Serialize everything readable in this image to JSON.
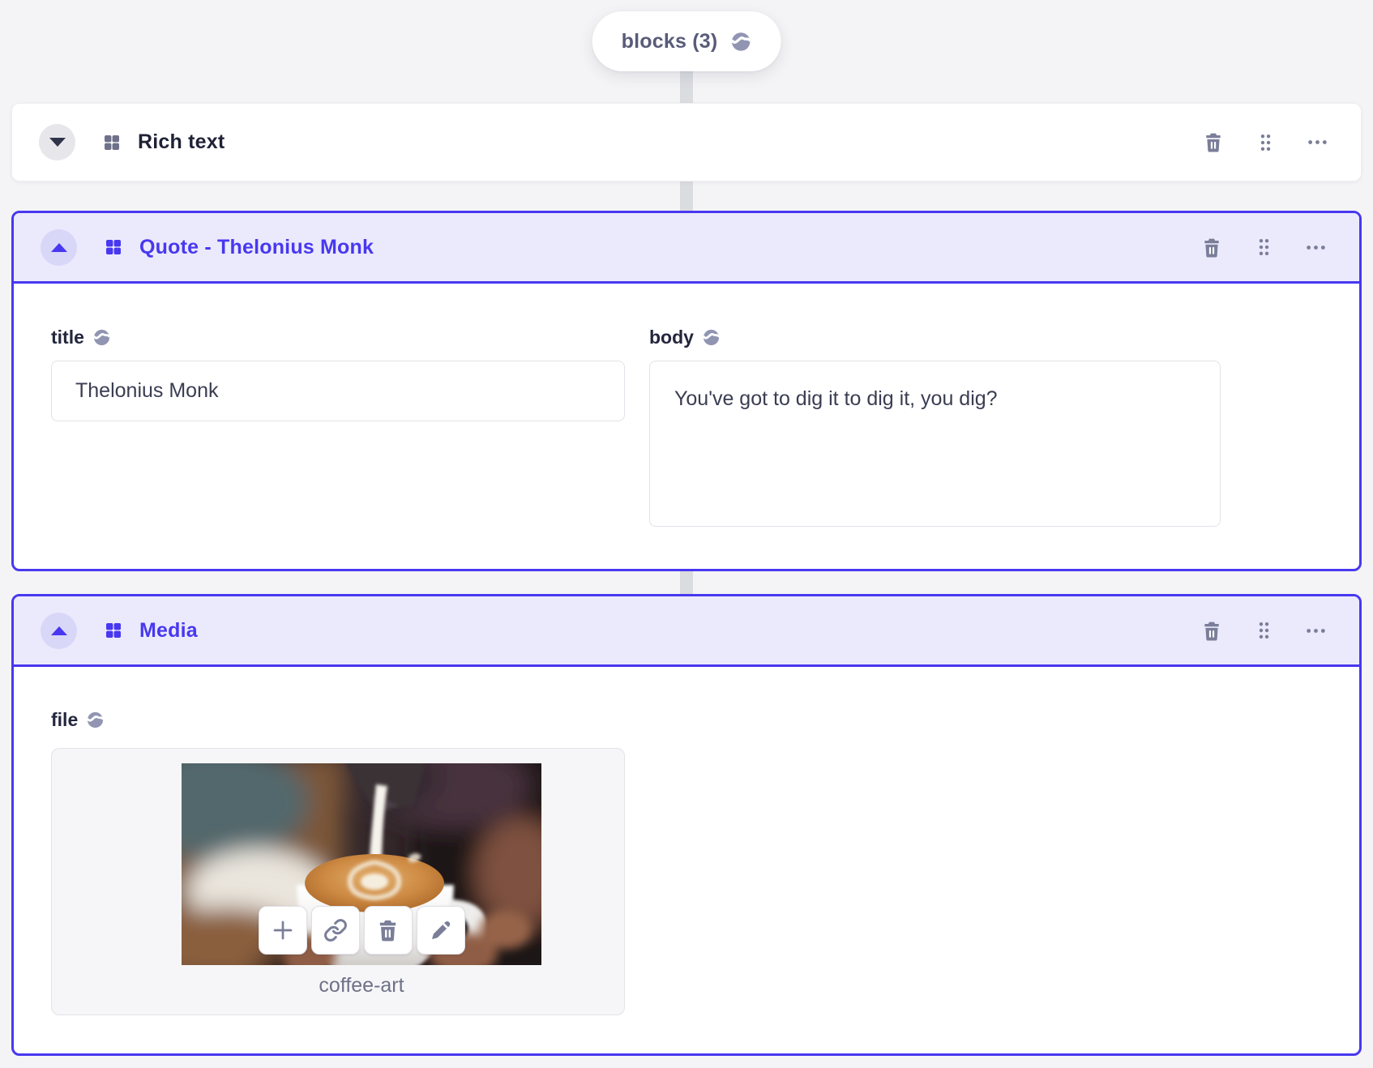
{
  "pill": {
    "label": "blocks (3)"
  },
  "colors": {
    "accent": "#4838f0",
    "accent_header_bg": "#ebeafc",
    "page_bg": "#f4f4f6",
    "icon_gray": "#7a7e98",
    "text_dark": "#1f2236"
  },
  "icons": {
    "pill": "globe-icon",
    "field_labels": "globe-icon",
    "collapse_collapsed": "chevron-down-icon",
    "collapse_expanded": "chevron-up-icon",
    "block_type": "blocks-grid-icon",
    "header_actions": [
      "trash-icon",
      "drag-handle-icon",
      "ellipsis-icon"
    ],
    "upload_actions": [
      "plus-icon",
      "link-icon",
      "trash-icon",
      "pencil-icon"
    ]
  },
  "blocks": [
    {
      "label": "Rich text",
      "state": "collapsed"
    },
    {
      "label": "Quote - Thelonius Monk",
      "state": "expanded",
      "fields": [
        {
          "name": "title",
          "type": "text",
          "value": "Thelonius Monk"
        },
        {
          "name": "body",
          "type": "textarea",
          "value": "You've got to dig it to dig it, you dig?"
        }
      ]
    },
    {
      "label": "Media",
      "state": "expanded",
      "fields": [
        {
          "name": "file",
          "type": "upload",
          "filename": "coffee-art"
        }
      ]
    }
  ]
}
